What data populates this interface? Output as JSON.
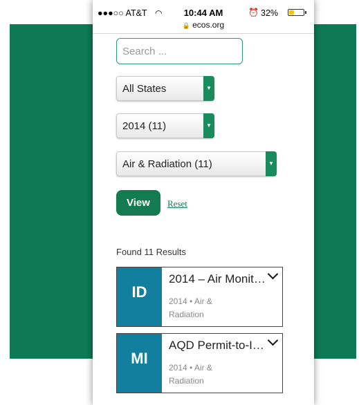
{
  "status_bar": {
    "carrier": "●●●○○ AT&T",
    "wifi_icon": "wifi-icon",
    "time": "10:44 AM",
    "alarm_icon": "alarm-icon",
    "battery": "32%",
    "url": "ecos.org"
  },
  "filters": {
    "search_placeholder": "Search ...",
    "state": "All States",
    "year": "2014 (11)",
    "topic": "Air & Radiation (11)",
    "view_label": "View",
    "reset_label": "Reset"
  },
  "results": {
    "summary": "Found 11 Results",
    "items": [
      {
        "state": "ID",
        "title": "2014 – Air Monito...",
        "meta": "2014 • Air & Radiation"
      },
      {
        "state": "MI",
        "title": "AQD Permit-to-In...",
        "meta": "2014 • Air & Radiation"
      }
    ]
  },
  "colors": {
    "brand_green": "#0e7a55",
    "badge_blue": "#137f9e",
    "battery_yellow": "#f0c419"
  }
}
